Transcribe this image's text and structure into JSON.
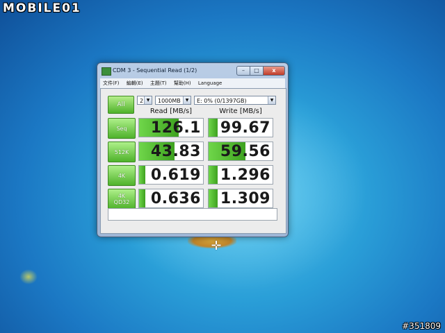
{
  "watermark": {
    "brand": "MOBILE01",
    "id": "#351809"
  },
  "window": {
    "title": "CDM 3 - Sequential Read (1/2)",
    "controls": {
      "minimize": "–",
      "maximize": "□",
      "close": "x"
    },
    "menu": [
      "文件(F)",
      "編輯(E)",
      "主題(T)",
      "幫助(H)",
      "Language"
    ],
    "all_button": "All",
    "test_count": "2",
    "test_size": "1000MB",
    "drive": "E: 0% (0/1397GB)",
    "headers": {
      "read": "Read [MB/s]",
      "write": "Write [MB/s]"
    },
    "rows": [
      {
        "label": "Seq",
        "read": "126.1",
        "write": "99.67",
        "read_fill": 0.62,
        "write_fill": 0.14
      },
      {
        "label": "512K",
        "read": "43.83",
        "write": "59.56",
        "read_fill": 0.55,
        "write_fill": 0.58
      },
      {
        "label": "4K",
        "read": "0.619",
        "write": "1.296",
        "read_fill": 0.1,
        "write_fill": 0.14
      },
      {
        "label": "4K\nQD32",
        "read": "0.636",
        "write": "1.309",
        "read_fill": 0.1,
        "write_fill": 0.14
      }
    ],
    "colors": {
      "accent": "#4fb22b",
      "close": "#c03c2a"
    }
  }
}
